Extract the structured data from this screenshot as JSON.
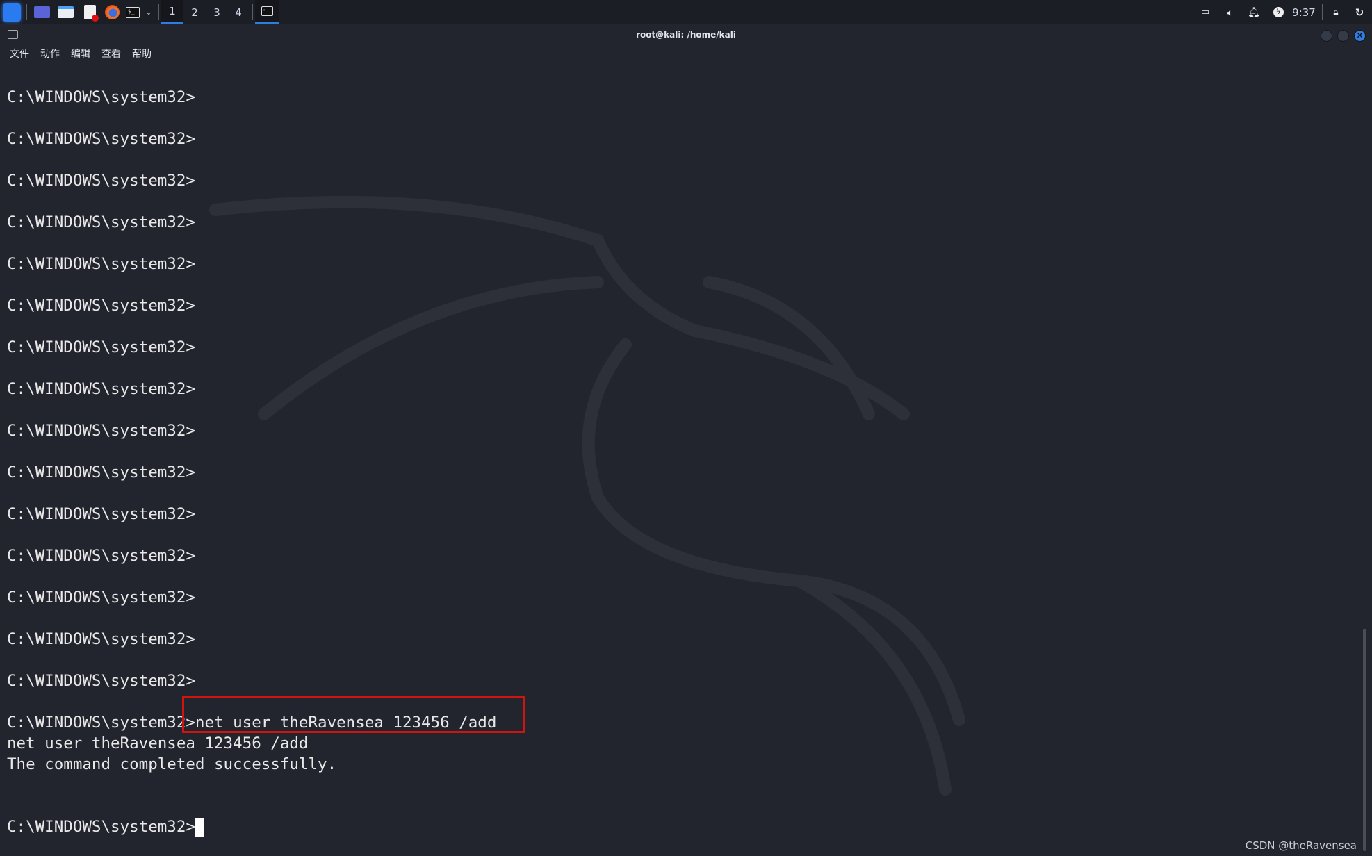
{
  "taskbar": {
    "apps": [
      "kali-menu-icon",
      "desktop-icon",
      "file-manager-icon",
      "text-editor-icon",
      "firefox-icon",
      "terminal-icon"
    ],
    "workspaces": [
      "1",
      "2",
      "3",
      "4"
    ],
    "active_workspace": "1",
    "clock": "9:37",
    "tray": [
      "network-icon",
      "volume-icon",
      "notification-icon",
      "power-icon",
      "lock-icon",
      "logout-icon"
    ]
  },
  "window": {
    "title": "root@kali: /home/kali",
    "menu": [
      "文件",
      "动作",
      "编辑",
      "查看",
      "帮助"
    ]
  },
  "terminal": {
    "prompt": "C:\\WINDOWS\\system32>",
    "empty_prompts": 15,
    "command_line": "C:\\WINDOWS\\system32>net user theRavensea 123456 /add",
    "echo": "net user theRavensea 123456 /add",
    "result": "The command completed successfully.",
    "final_prompt": "C:\\WINDOWS\\system32>"
  },
  "highlight_color": "#d2140f",
  "watermark": "CSDN @theRavensea"
}
